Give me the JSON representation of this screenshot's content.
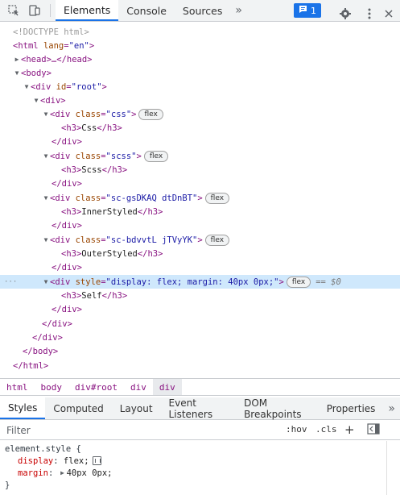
{
  "toolbar": {
    "tabs": [
      "Elements",
      "Console",
      "Sources"
    ],
    "more_label": "»",
    "issues_count": "1"
  },
  "tree": {
    "doctype": "<!DOCTYPE html>",
    "html_open": "<html",
    "html_lang_attr": "lang",
    "html_lang_val": "\"en\"",
    "head_collapsed": "<head>…</head>",
    "body_open": "<body>",
    "div_root_open": "<div",
    "root_attr": "id",
    "root_val": "\"root\"",
    "div_open": "<div>",
    "class_attr": "class",
    "style_attr": "style",
    "blocks": [
      {
        "class_val": "\"css\"",
        "h3": "Css"
      },
      {
        "class_val": "\"scss\"",
        "h3": "Scss"
      },
      {
        "class_val": "\"sc-gsDKAQ dtDnBT\"",
        "h3": "InnerStyled"
      },
      {
        "class_val": "\"sc-bdvvtL jTVyYK\"",
        "h3": "OuterStyled"
      }
    ],
    "selected_style_val": "\"display: flex; margin: 40px 0px;\"",
    "selected_h3": "Self",
    "flex_badge": "flex",
    "eq_label": "== $0",
    "div_close": "</div>",
    "body_close": "</body>",
    "html_close": "</html>"
  },
  "breadcrumb": [
    "html",
    "body",
    "div#root",
    "div",
    "div"
  ],
  "side_tabs": [
    "Styles",
    "Computed",
    "Layout",
    "Event Listeners",
    "DOM Breakpoints",
    "Properties"
  ],
  "filter": {
    "placeholder": "Filter",
    "hov": ":hov",
    "cls": ".cls",
    "plus": "+"
  },
  "styles": {
    "selector": "element.style {",
    "props": [
      {
        "name": "display",
        "value": "flex;"
      },
      {
        "name": "margin",
        "value": "40px 0px;"
      }
    ],
    "close": "}"
  }
}
